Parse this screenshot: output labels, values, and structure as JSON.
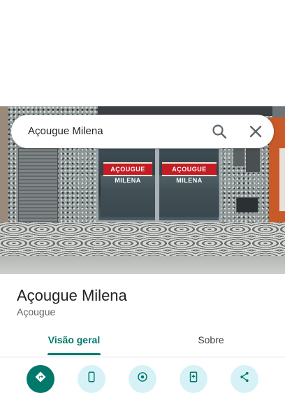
{
  "search": {
    "query": "Açougue Milena"
  },
  "photo": {
    "sign_text": "AÇOUGUE MILENA"
  },
  "place": {
    "name": "Açougue Milena",
    "category": "Açougue"
  },
  "tabs": [
    {
      "label": "Visão geral",
      "active": true
    },
    {
      "label": "Sobre",
      "active": false
    }
  ],
  "actions": [
    {
      "icon": "directions-icon",
      "primary": true
    },
    {
      "icon": "phone-icon",
      "primary": false
    },
    {
      "icon": "navigation-icon",
      "primary": false
    },
    {
      "icon": "save-icon",
      "primary": false
    },
    {
      "icon": "share-icon",
      "primary": false
    }
  ],
  "colors": {
    "accent": "#00796b",
    "secondary_button": "#d7f2f7",
    "sign_red": "#c41c24"
  }
}
